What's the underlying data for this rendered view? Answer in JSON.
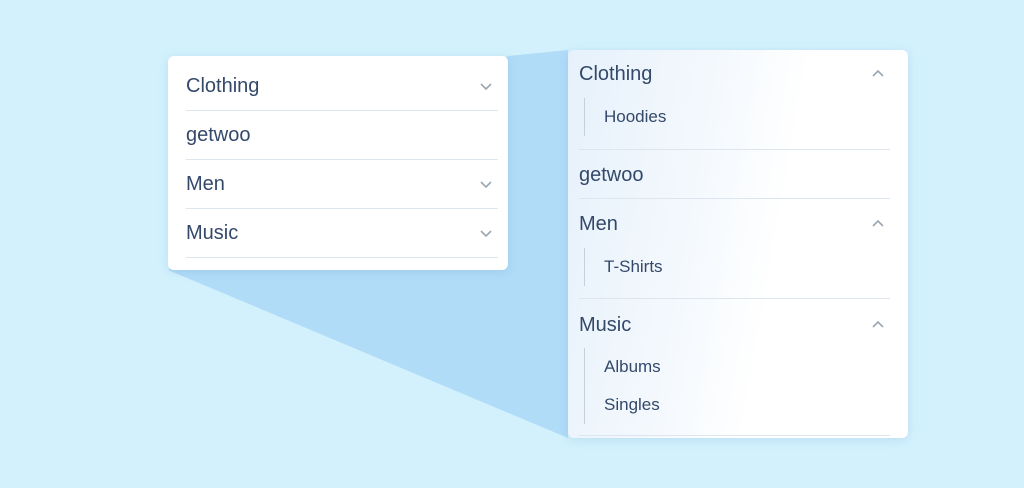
{
  "collapsed_menu": {
    "items": [
      {
        "label": "Clothing"
      },
      {
        "label": "getwoo"
      },
      {
        "label": "Men"
      },
      {
        "label": "Music"
      }
    ]
  },
  "expanded_menu": {
    "items": [
      {
        "label": "Clothing",
        "children": [
          "Hoodies"
        ]
      },
      {
        "label": "getwoo"
      },
      {
        "label": "Men",
        "children": [
          "T-Shirts"
        ]
      },
      {
        "label": "Music",
        "children": [
          "Albums",
          "Singles"
        ]
      }
    ]
  },
  "icons": {
    "collapsed_chevron": "chevron-down-icon",
    "expanded_chevron": "chevron-up-icon"
  },
  "colors": {
    "background": "#d3f1fd",
    "beam": "#a9d8f7",
    "text": "#34496a",
    "divider": "#dde6ee",
    "chevron": "#9aa6b2"
  }
}
